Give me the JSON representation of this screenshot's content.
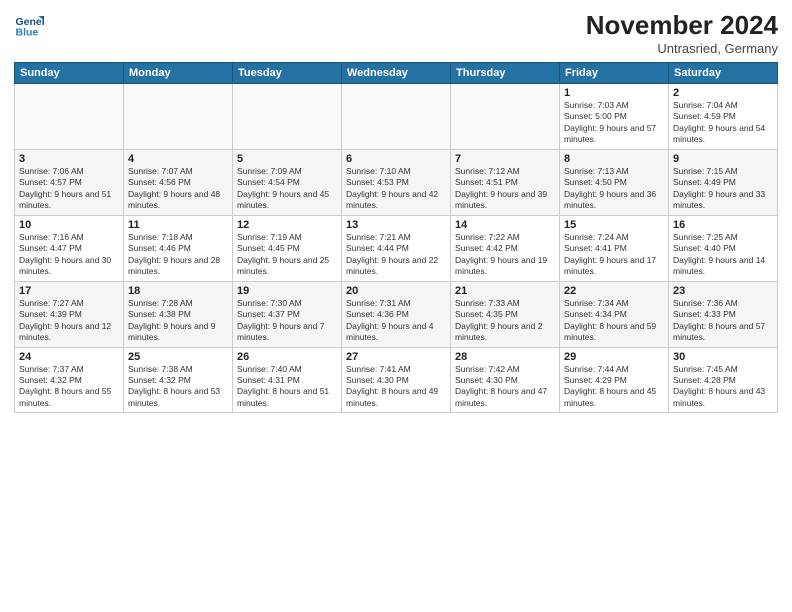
{
  "logo": {
    "line1": "General",
    "line2": "Blue"
  },
  "title": "November 2024",
  "subtitle": "Untrasried, Germany",
  "headers": [
    "Sunday",
    "Monday",
    "Tuesday",
    "Wednesday",
    "Thursday",
    "Friday",
    "Saturday"
  ],
  "weeks": [
    [
      {
        "day": "",
        "detail": ""
      },
      {
        "day": "",
        "detail": ""
      },
      {
        "day": "",
        "detail": ""
      },
      {
        "day": "",
        "detail": ""
      },
      {
        "day": "",
        "detail": ""
      },
      {
        "day": "1",
        "detail": "Sunrise: 7:03 AM\nSunset: 5:00 PM\nDaylight: 9 hours and 57 minutes."
      },
      {
        "day": "2",
        "detail": "Sunrise: 7:04 AM\nSunset: 4:59 PM\nDaylight: 9 hours and 54 minutes."
      }
    ],
    [
      {
        "day": "3",
        "detail": "Sunrise: 7:06 AM\nSunset: 4:57 PM\nDaylight: 9 hours and 51 minutes."
      },
      {
        "day": "4",
        "detail": "Sunrise: 7:07 AM\nSunset: 4:56 PM\nDaylight: 9 hours and 48 minutes."
      },
      {
        "day": "5",
        "detail": "Sunrise: 7:09 AM\nSunset: 4:54 PM\nDaylight: 9 hours and 45 minutes."
      },
      {
        "day": "6",
        "detail": "Sunrise: 7:10 AM\nSunset: 4:53 PM\nDaylight: 9 hours and 42 minutes."
      },
      {
        "day": "7",
        "detail": "Sunrise: 7:12 AM\nSunset: 4:51 PM\nDaylight: 9 hours and 39 minutes."
      },
      {
        "day": "8",
        "detail": "Sunrise: 7:13 AM\nSunset: 4:50 PM\nDaylight: 9 hours and 36 minutes."
      },
      {
        "day": "9",
        "detail": "Sunrise: 7:15 AM\nSunset: 4:49 PM\nDaylight: 9 hours and 33 minutes."
      }
    ],
    [
      {
        "day": "10",
        "detail": "Sunrise: 7:16 AM\nSunset: 4:47 PM\nDaylight: 9 hours and 30 minutes."
      },
      {
        "day": "11",
        "detail": "Sunrise: 7:18 AM\nSunset: 4:46 PM\nDaylight: 9 hours and 28 minutes."
      },
      {
        "day": "12",
        "detail": "Sunrise: 7:19 AM\nSunset: 4:45 PM\nDaylight: 9 hours and 25 minutes."
      },
      {
        "day": "13",
        "detail": "Sunrise: 7:21 AM\nSunset: 4:44 PM\nDaylight: 9 hours and 22 minutes."
      },
      {
        "day": "14",
        "detail": "Sunrise: 7:22 AM\nSunset: 4:42 PM\nDaylight: 9 hours and 19 minutes."
      },
      {
        "day": "15",
        "detail": "Sunrise: 7:24 AM\nSunset: 4:41 PM\nDaylight: 9 hours and 17 minutes."
      },
      {
        "day": "16",
        "detail": "Sunrise: 7:25 AM\nSunset: 4:40 PM\nDaylight: 9 hours and 14 minutes."
      }
    ],
    [
      {
        "day": "17",
        "detail": "Sunrise: 7:27 AM\nSunset: 4:39 PM\nDaylight: 9 hours and 12 minutes."
      },
      {
        "day": "18",
        "detail": "Sunrise: 7:28 AM\nSunset: 4:38 PM\nDaylight: 9 hours and 9 minutes."
      },
      {
        "day": "19",
        "detail": "Sunrise: 7:30 AM\nSunset: 4:37 PM\nDaylight: 9 hours and 7 minutes."
      },
      {
        "day": "20",
        "detail": "Sunrise: 7:31 AM\nSunset: 4:36 PM\nDaylight: 9 hours and 4 minutes."
      },
      {
        "day": "21",
        "detail": "Sunrise: 7:33 AM\nSunset: 4:35 PM\nDaylight: 9 hours and 2 minutes."
      },
      {
        "day": "22",
        "detail": "Sunrise: 7:34 AM\nSunset: 4:34 PM\nDaylight: 8 hours and 59 minutes."
      },
      {
        "day": "23",
        "detail": "Sunrise: 7:36 AM\nSunset: 4:33 PM\nDaylight: 8 hours and 57 minutes."
      }
    ],
    [
      {
        "day": "24",
        "detail": "Sunrise: 7:37 AM\nSunset: 4:32 PM\nDaylight: 8 hours and 55 minutes."
      },
      {
        "day": "25",
        "detail": "Sunrise: 7:38 AM\nSunset: 4:32 PM\nDaylight: 8 hours and 53 minutes."
      },
      {
        "day": "26",
        "detail": "Sunrise: 7:40 AM\nSunset: 4:31 PM\nDaylight: 8 hours and 51 minutes."
      },
      {
        "day": "27",
        "detail": "Sunrise: 7:41 AM\nSunset: 4:30 PM\nDaylight: 8 hours and 49 minutes."
      },
      {
        "day": "28",
        "detail": "Sunrise: 7:42 AM\nSunset: 4:30 PM\nDaylight: 8 hours and 47 minutes."
      },
      {
        "day": "29",
        "detail": "Sunrise: 7:44 AM\nSunset: 4:29 PM\nDaylight: 8 hours and 45 minutes."
      },
      {
        "day": "30",
        "detail": "Sunrise: 7:45 AM\nSunset: 4:28 PM\nDaylight: 8 hours and 43 minutes."
      }
    ]
  ]
}
